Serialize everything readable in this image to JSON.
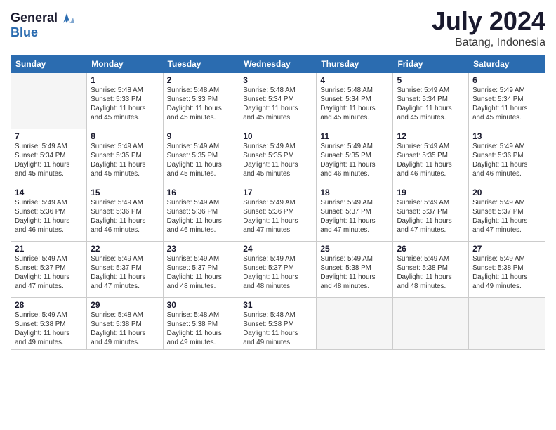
{
  "header": {
    "logo_line1": "General",
    "logo_line2": "Blue",
    "month_year": "July 2024",
    "location": "Batang, Indonesia"
  },
  "weekdays": [
    "Sunday",
    "Monday",
    "Tuesday",
    "Wednesday",
    "Thursday",
    "Friday",
    "Saturday"
  ],
  "weeks": [
    [
      {
        "day": "",
        "info": ""
      },
      {
        "day": "1",
        "info": "Sunrise: 5:48 AM\nSunset: 5:33 PM\nDaylight: 11 hours\nand 45 minutes."
      },
      {
        "day": "2",
        "info": "Sunrise: 5:48 AM\nSunset: 5:33 PM\nDaylight: 11 hours\nand 45 minutes."
      },
      {
        "day": "3",
        "info": "Sunrise: 5:48 AM\nSunset: 5:34 PM\nDaylight: 11 hours\nand 45 minutes."
      },
      {
        "day": "4",
        "info": "Sunrise: 5:48 AM\nSunset: 5:34 PM\nDaylight: 11 hours\nand 45 minutes."
      },
      {
        "day": "5",
        "info": "Sunrise: 5:49 AM\nSunset: 5:34 PM\nDaylight: 11 hours\nand 45 minutes."
      },
      {
        "day": "6",
        "info": "Sunrise: 5:49 AM\nSunset: 5:34 PM\nDaylight: 11 hours\nand 45 minutes."
      }
    ],
    [
      {
        "day": "7",
        "info": "Sunrise: 5:49 AM\nSunset: 5:34 PM\nDaylight: 11 hours\nand 45 minutes."
      },
      {
        "day": "8",
        "info": "Sunrise: 5:49 AM\nSunset: 5:35 PM\nDaylight: 11 hours\nand 45 minutes."
      },
      {
        "day": "9",
        "info": "Sunrise: 5:49 AM\nSunset: 5:35 PM\nDaylight: 11 hours\nand 45 minutes."
      },
      {
        "day": "10",
        "info": "Sunrise: 5:49 AM\nSunset: 5:35 PM\nDaylight: 11 hours\nand 45 minutes."
      },
      {
        "day": "11",
        "info": "Sunrise: 5:49 AM\nSunset: 5:35 PM\nDaylight: 11 hours\nand 46 minutes."
      },
      {
        "day": "12",
        "info": "Sunrise: 5:49 AM\nSunset: 5:35 PM\nDaylight: 11 hours\nand 46 minutes."
      },
      {
        "day": "13",
        "info": "Sunrise: 5:49 AM\nSunset: 5:36 PM\nDaylight: 11 hours\nand 46 minutes."
      }
    ],
    [
      {
        "day": "14",
        "info": "Sunrise: 5:49 AM\nSunset: 5:36 PM\nDaylight: 11 hours\nand 46 minutes."
      },
      {
        "day": "15",
        "info": "Sunrise: 5:49 AM\nSunset: 5:36 PM\nDaylight: 11 hours\nand 46 minutes."
      },
      {
        "day": "16",
        "info": "Sunrise: 5:49 AM\nSunset: 5:36 PM\nDaylight: 11 hours\nand 46 minutes."
      },
      {
        "day": "17",
        "info": "Sunrise: 5:49 AM\nSunset: 5:36 PM\nDaylight: 11 hours\nand 47 minutes."
      },
      {
        "day": "18",
        "info": "Sunrise: 5:49 AM\nSunset: 5:37 PM\nDaylight: 11 hours\nand 47 minutes."
      },
      {
        "day": "19",
        "info": "Sunrise: 5:49 AM\nSunset: 5:37 PM\nDaylight: 11 hours\nand 47 minutes."
      },
      {
        "day": "20",
        "info": "Sunrise: 5:49 AM\nSunset: 5:37 PM\nDaylight: 11 hours\nand 47 minutes."
      }
    ],
    [
      {
        "day": "21",
        "info": "Sunrise: 5:49 AM\nSunset: 5:37 PM\nDaylight: 11 hours\nand 47 minutes."
      },
      {
        "day": "22",
        "info": "Sunrise: 5:49 AM\nSunset: 5:37 PM\nDaylight: 11 hours\nand 47 minutes."
      },
      {
        "day": "23",
        "info": "Sunrise: 5:49 AM\nSunset: 5:37 PM\nDaylight: 11 hours\nand 48 minutes."
      },
      {
        "day": "24",
        "info": "Sunrise: 5:49 AM\nSunset: 5:37 PM\nDaylight: 11 hours\nand 48 minutes."
      },
      {
        "day": "25",
        "info": "Sunrise: 5:49 AM\nSunset: 5:38 PM\nDaylight: 11 hours\nand 48 minutes."
      },
      {
        "day": "26",
        "info": "Sunrise: 5:49 AM\nSunset: 5:38 PM\nDaylight: 11 hours\nand 48 minutes."
      },
      {
        "day": "27",
        "info": "Sunrise: 5:49 AM\nSunset: 5:38 PM\nDaylight: 11 hours\nand 49 minutes."
      }
    ],
    [
      {
        "day": "28",
        "info": "Sunrise: 5:49 AM\nSunset: 5:38 PM\nDaylight: 11 hours\nand 49 minutes."
      },
      {
        "day": "29",
        "info": "Sunrise: 5:48 AM\nSunset: 5:38 PM\nDaylight: 11 hours\nand 49 minutes."
      },
      {
        "day": "30",
        "info": "Sunrise: 5:48 AM\nSunset: 5:38 PM\nDaylight: 11 hours\nand 49 minutes."
      },
      {
        "day": "31",
        "info": "Sunrise: 5:48 AM\nSunset: 5:38 PM\nDaylight: 11 hours\nand 49 minutes."
      },
      {
        "day": "",
        "info": ""
      },
      {
        "day": "",
        "info": ""
      },
      {
        "day": "",
        "info": ""
      }
    ]
  ]
}
